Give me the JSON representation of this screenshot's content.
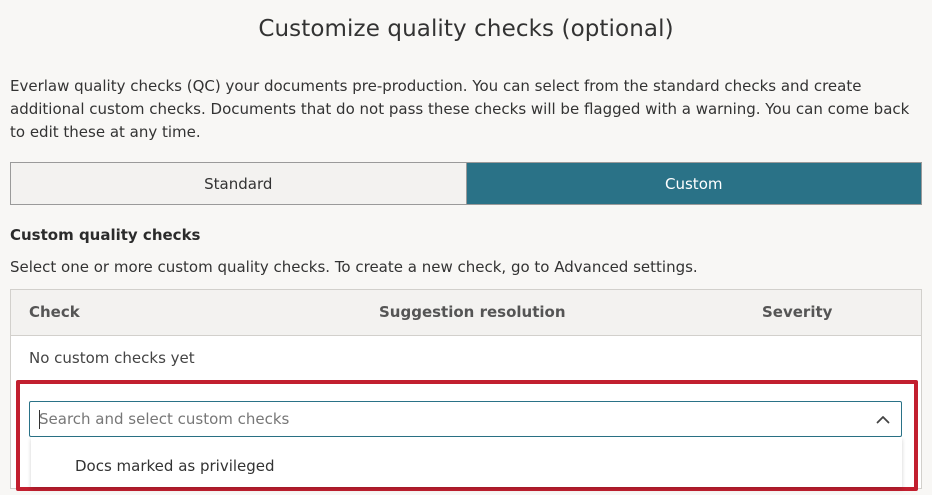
{
  "page": {
    "title": "Customize quality checks (optional)",
    "intro": "Everlaw quality checks (QC) your documents pre-production. You can select from the standard checks and create additional custom checks. Documents that do not pass these checks will be flagged with a warning. You can come back to edit these at any time."
  },
  "toggle": {
    "standard_label": "Standard",
    "custom_label": "Custom",
    "selected": "Custom"
  },
  "custom_section": {
    "heading": "Custom quality checks",
    "description": "Select one or more custom quality checks. To create a new check, go to Advanced settings."
  },
  "table": {
    "columns": [
      "Check",
      "Suggestion resolution",
      "Severity"
    ],
    "empty_text": "No custom checks yet"
  },
  "combobox": {
    "placeholder": "Search and select custom checks",
    "value": "",
    "chevron_icon": "chevron-up-icon",
    "options": [
      "Docs marked as privileged"
    ]
  },
  "colors": {
    "accent": "#2a7287",
    "highlight": "#c21f2f",
    "background": "#f8f7f5"
  }
}
